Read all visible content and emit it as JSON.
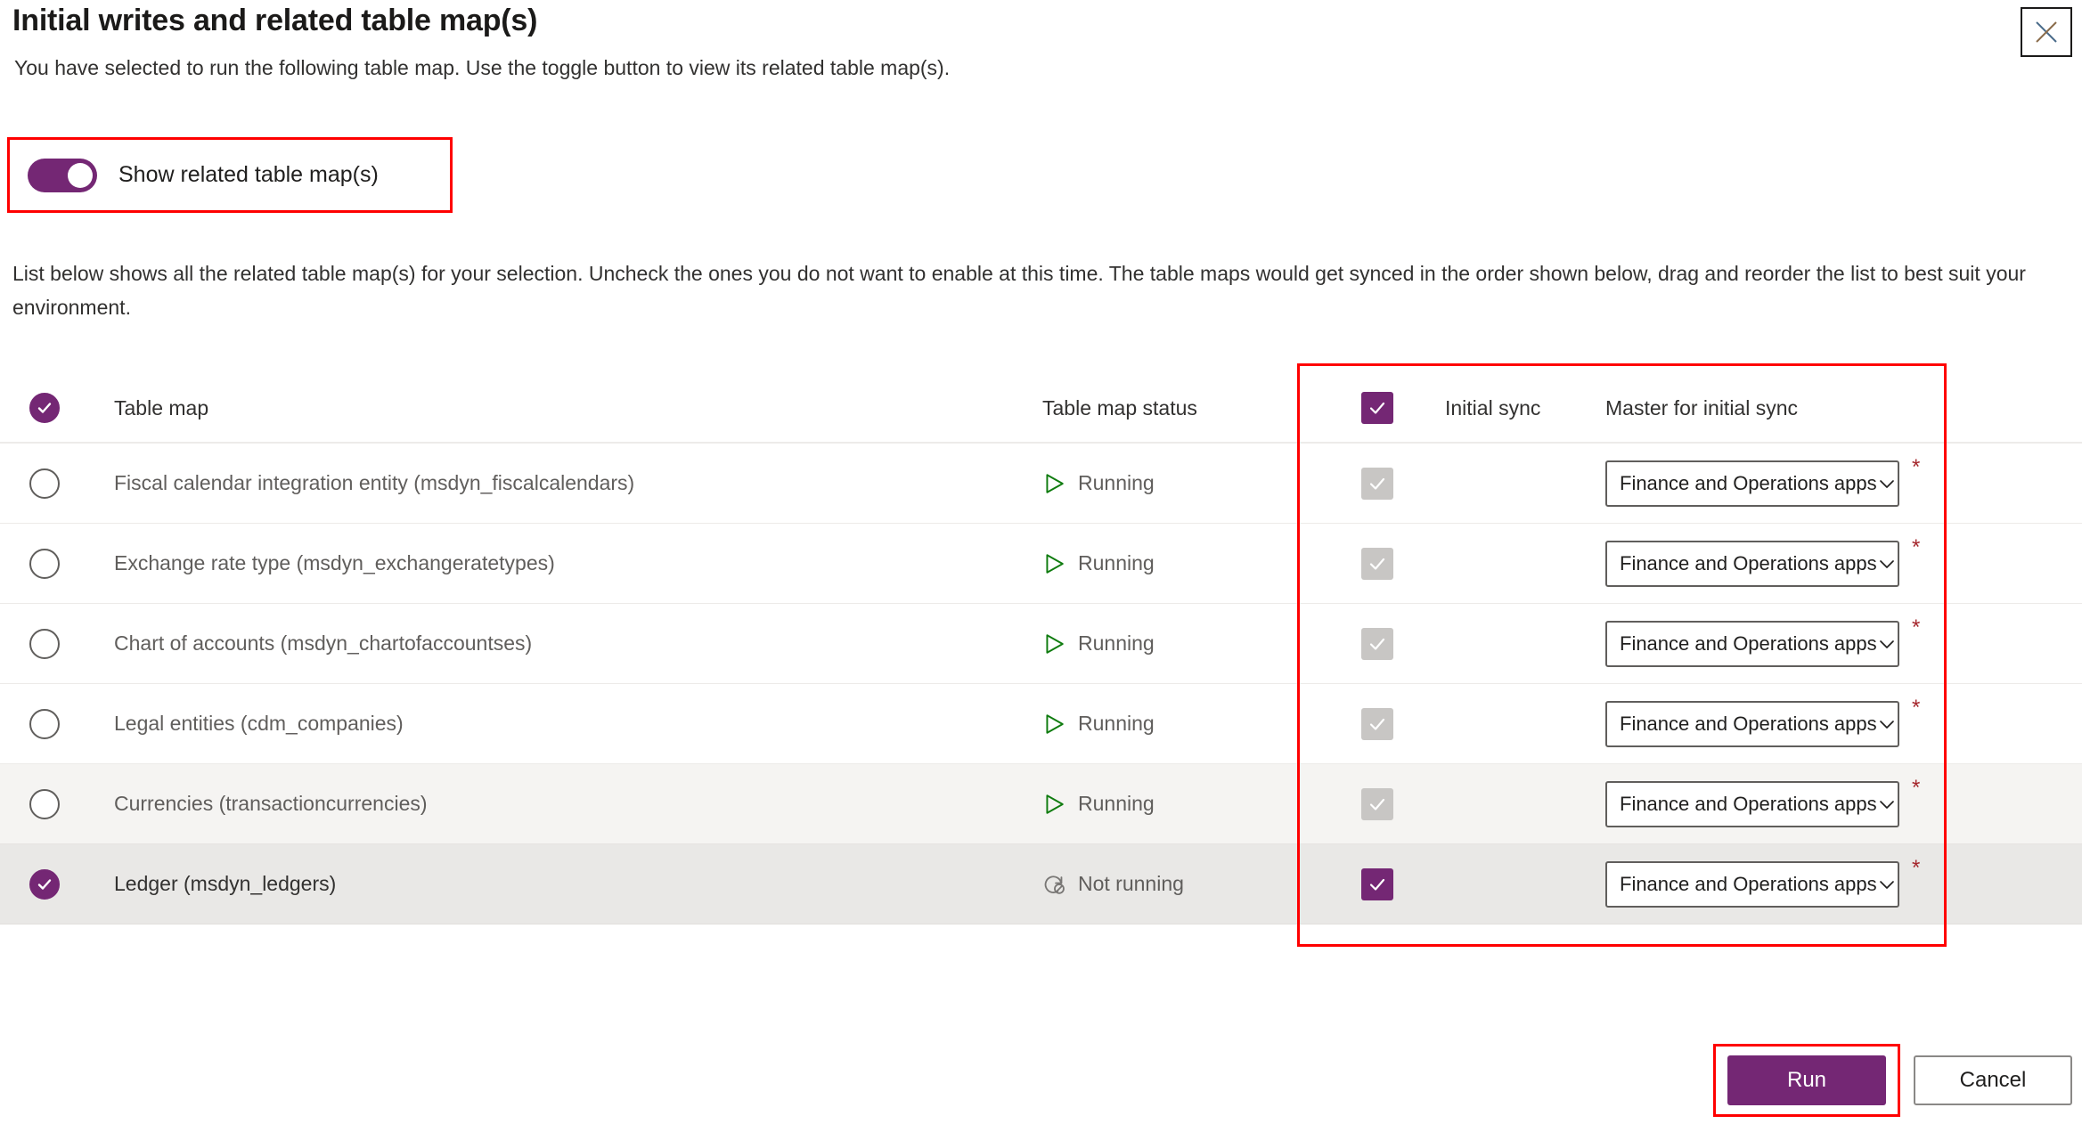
{
  "dialog": {
    "title": "Initial writes and related table map(s)",
    "subtitle": "You have selected to run the following table map. Use the toggle button to view its related table map(s).",
    "close_icon": "close-icon",
    "intro": "List below shows all the related table map(s) for your selection. Uncheck the ones you do not want to enable at this time. The table maps would get synced in the order shown below, drag and reorder the list to best suit your environment."
  },
  "toggle": {
    "label": "Show related table map(s)",
    "on": true
  },
  "table": {
    "headers": {
      "table_map": "Table map",
      "table_map_status": "Table map status",
      "initial_sync": "Initial sync",
      "master_for_initial_sync": "Master for initial sync"
    },
    "header_select_all_checked": true,
    "header_initial_sync_checked": true,
    "rows": [
      {
        "name": "Fiscal calendar integration entity (msdyn_fiscalcalendars)",
        "status": "Running",
        "status_icon": "play-icon",
        "selected": false,
        "initial_sync_checked": true,
        "initial_sync_disabled": true,
        "master": "Finance and Operations apps",
        "required": "*",
        "shade": "none"
      },
      {
        "name": "Exchange rate type (msdyn_exchangeratetypes)",
        "status": "Running",
        "status_icon": "play-icon",
        "selected": false,
        "initial_sync_checked": true,
        "initial_sync_disabled": true,
        "master": "Finance and Operations apps",
        "required": "*",
        "shade": "none"
      },
      {
        "name": "Chart of accounts (msdyn_chartofaccountses)",
        "status": "Running",
        "status_icon": "play-icon",
        "selected": false,
        "initial_sync_checked": true,
        "initial_sync_disabled": true,
        "master": "Finance and Operations apps",
        "required": "*",
        "shade": "none"
      },
      {
        "name": "Legal entities (cdm_companies)",
        "status": "Running",
        "status_icon": "play-icon",
        "selected": false,
        "initial_sync_checked": true,
        "initial_sync_disabled": true,
        "master": "Finance and Operations apps",
        "required": "*",
        "shade": "none"
      },
      {
        "name": "Currencies (transactioncurrencies)",
        "status": "Running",
        "status_icon": "play-icon",
        "selected": false,
        "initial_sync_checked": true,
        "initial_sync_disabled": true,
        "master": "Finance and Operations apps",
        "required": "*",
        "shade": "a"
      },
      {
        "name": "Ledger (msdyn_ledgers)",
        "status": "Not running",
        "status_icon": "not-running-icon",
        "selected": true,
        "initial_sync_checked": true,
        "initial_sync_disabled": false,
        "master": "Finance and Operations apps",
        "required": "*",
        "shade": "b"
      }
    ]
  },
  "footer": {
    "run_label": "Run",
    "cancel_label": "Cancel"
  },
  "colors": {
    "accent_purple": "#742774",
    "highlight_red": "#ff0000",
    "running_green": "#107c10",
    "required_red": "#a4262c",
    "disabled_gray": "#c8c6c4"
  }
}
